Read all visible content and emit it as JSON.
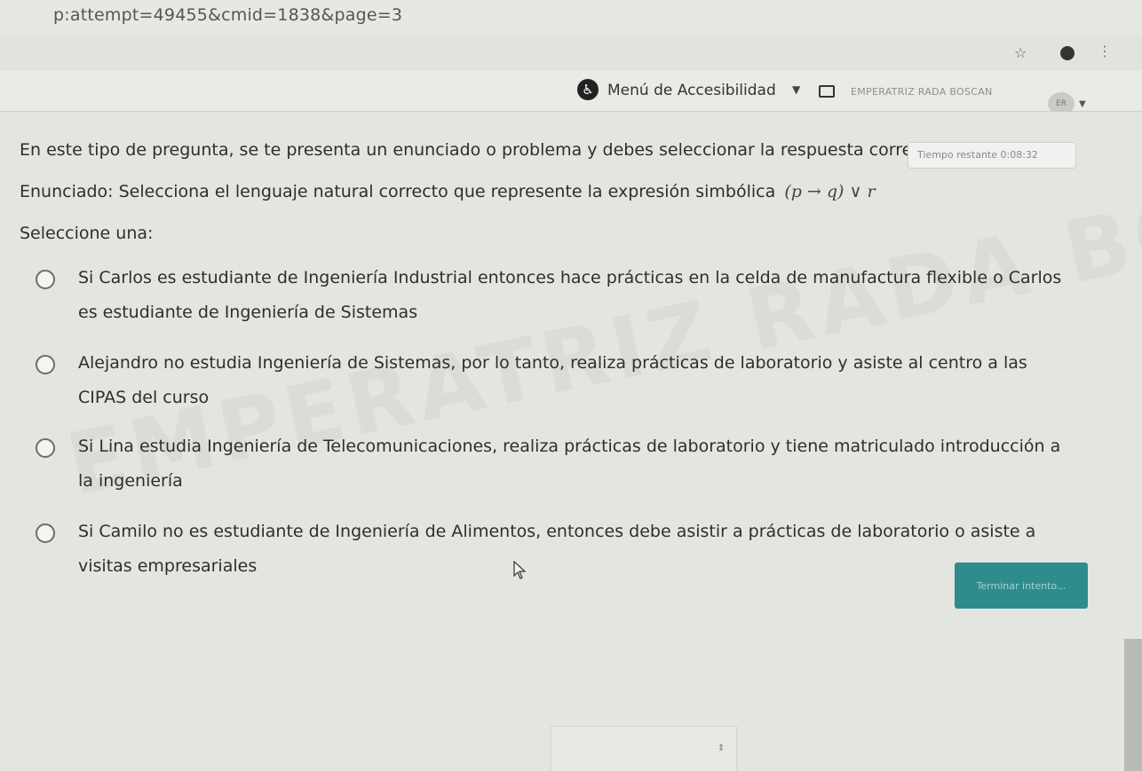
{
  "browser": {
    "url_fragment": "p:attempt=49455&cmid=1838&page=3"
  },
  "navbar": {
    "accessibility_menu": "Menú de Accesibilidad",
    "user_name": "EMPERATRIZ RADA BOSCAN"
  },
  "quiz": {
    "instructions": "En este tipo de pregunta, se te presenta un enunciado o problema y debes seleccionar la respuesta correc",
    "timer_label": "Tiempo restante 0:08:32",
    "statement": "Enunciado: Selecciona el lenguaje natural correcto que represente la expresión simbólica",
    "expression": "(p → q) ∨ r",
    "select_prompt": "Seleccione una:",
    "options": [
      {
        "text": "Si Carlos es estudiante de Ingeniería Industrial entonces hace prácticas en la celda de manufactura flexible o Carlos es estudiante de Ingeniería de Sistemas",
        "selected": false
      },
      {
        "text": "Alejandro no estudia Ingeniería de Sistemas, por lo tanto, realiza prácticas de laboratorio y asiste al centro a las CIPAS del curso",
        "selected": false
      },
      {
        "text": "Si Lina estudia Ingeniería de Telecomunicaciones, realiza prácticas de laboratorio y tiene matriculado introducción a la ingeniería",
        "selected": false
      },
      {
        "text": "Si Camilo no es estudiante de Ingeniería de Alimentos, entonces debe asistir a prácticas de laboratorio o asiste a visitas empresariales",
        "selected": false
      }
    ],
    "finish_button": "Terminar intento..."
  },
  "watermark": "EMPERATRIZ RADA BOSCAN"
}
